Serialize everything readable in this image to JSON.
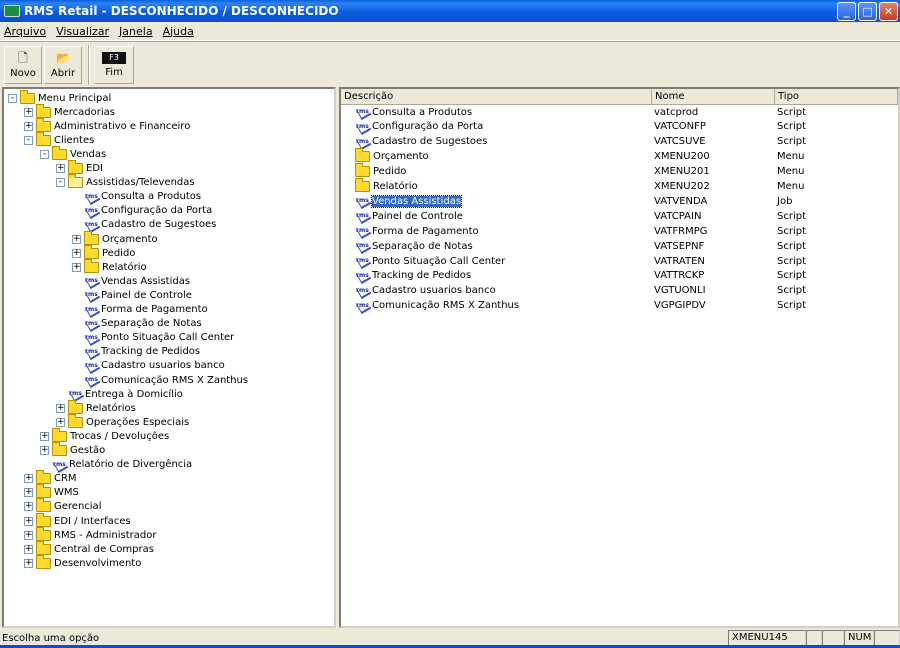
{
  "window": {
    "title": "RMS Retail - DESCONHECIDO / DESCONHECIDO"
  },
  "menu": [
    "Arquivo",
    "Visualizar",
    "Janela",
    "Ajuda"
  ],
  "toolbar": {
    "novo": "Novo",
    "abrir": "Abrir",
    "fim": "Fim",
    "fim_key": "F3"
  },
  "tree": [
    {
      "label": "Menu Principal",
      "icon": "folder",
      "expander": "-"
    },
    {
      "label": "Mercadorias",
      "icon": "folder",
      "expander": "+"
    },
    {
      "label": "Administrativo e Financeiro",
      "icon": "folder",
      "expander": "+"
    },
    {
      "label": "Clientes",
      "icon": "folder",
      "expander": "-"
    },
    {
      "label": "Vendas",
      "icon": "folder",
      "expander": "-"
    },
    {
      "label": "EDI",
      "icon": "folder",
      "expander": "+"
    },
    {
      "label": "Assistidas/Televendas",
      "icon": "folder-open",
      "expander": "-"
    },
    {
      "label": "Consulta a Produtos",
      "icon": "program",
      "expander": ""
    },
    {
      "label": "Configuração da Porta",
      "icon": "program",
      "expander": ""
    },
    {
      "label": "Cadastro de Sugestoes",
      "icon": "program",
      "expander": ""
    },
    {
      "label": "Orçamento",
      "icon": "folder",
      "expander": "+"
    },
    {
      "label": "Pedido",
      "icon": "folder",
      "expander": "+"
    },
    {
      "label": "Relatório",
      "icon": "folder",
      "expander": "+"
    },
    {
      "label": "Vendas Assistidas",
      "icon": "program",
      "expander": ""
    },
    {
      "label": "Painel de Controle",
      "icon": "program",
      "expander": ""
    },
    {
      "label": "Forma de Pagamento",
      "icon": "program",
      "expander": ""
    },
    {
      "label": "Separação de Notas",
      "icon": "program",
      "expander": ""
    },
    {
      "label": "Ponto Situação Call Center",
      "icon": "program",
      "expander": ""
    },
    {
      "label": "Tracking de Pedidos",
      "icon": "program",
      "expander": ""
    },
    {
      "label": "Cadastro usuarios banco",
      "icon": "program",
      "expander": ""
    },
    {
      "label": "Comunicação RMS X Zanthus",
      "icon": "program",
      "expander": ""
    },
    {
      "label": "Entrega à Domicílio",
      "icon": "program",
      "expander": ""
    },
    {
      "label": "Relatórios",
      "icon": "folder",
      "expander": "+"
    },
    {
      "label": "Operações Especiais",
      "icon": "folder",
      "expander": "+"
    },
    {
      "label": "Trocas / Devoluções",
      "icon": "folder",
      "expander": "+"
    },
    {
      "label": "Gestão",
      "icon": "folder",
      "expander": "+"
    },
    {
      "label": "Relatório de Divergência",
      "icon": "program",
      "expander": ""
    },
    {
      "label": "CRM",
      "icon": "folder",
      "expander": "+"
    },
    {
      "label": "WMS",
      "icon": "folder",
      "expander": "+"
    },
    {
      "label": "Gerencial",
      "icon": "folder",
      "expander": "+"
    },
    {
      "label": "EDI / Interfaces",
      "icon": "folder",
      "expander": "+"
    },
    {
      "label": "RMS - Administrador",
      "icon": "folder",
      "expander": "+"
    },
    {
      "label": "Central de Compras",
      "icon": "folder",
      "expander": "+"
    },
    {
      "label": "Desenvolvimento",
      "icon": "folder",
      "expander": "+"
    }
  ],
  "list": {
    "headers": [
      "Descrição",
      "Nome",
      "Tipo"
    ],
    "rows": [
      {
        "desc": "Consulta a Produtos",
        "nome": "vatcprod",
        "tipo": "Script",
        "icon": "program"
      },
      {
        "desc": "Configuração da Porta",
        "nome": "VATCONFP",
        "tipo": "Script",
        "icon": "program"
      },
      {
        "desc": "Cadastro de Sugestoes",
        "nome": "VATCSUVE",
        "tipo": "Script",
        "icon": "program"
      },
      {
        "desc": "Orçamento",
        "nome": "XMENU200",
        "tipo": "Menu",
        "icon": "folder"
      },
      {
        "desc": "Pedido",
        "nome": "XMENU201",
        "tipo": "Menu",
        "icon": "folder"
      },
      {
        "desc": "Relatório",
        "nome": "XMENU202",
        "tipo": "Menu",
        "icon": "folder"
      },
      {
        "desc": "Vendas Assistidas",
        "nome": "VATVENDA",
        "tipo": "Job",
        "icon": "program"
      },
      {
        "desc": "Painel de Controle",
        "nome": "VATCPAIN",
        "tipo": "Script",
        "icon": "program"
      },
      {
        "desc": "Forma de Pagamento",
        "nome": "VATFRMPG",
        "tipo": "Script",
        "icon": "program"
      },
      {
        "desc": "Separação de Notas",
        "nome": "VATSEPNF",
        "tipo": "Script",
        "icon": "program"
      },
      {
        "desc": "Ponto Situação Call Center",
        "nome": "VATRATEN",
        "tipo": "Script",
        "icon": "program"
      },
      {
        "desc": "Tracking de Pedidos",
        "nome": "VATTRCKP",
        "tipo": "Script",
        "icon": "program"
      },
      {
        "desc": "Cadastro usuarios banco",
        "nome": "VGTUONLI",
        "tipo": "Script",
        "icon": "program"
      },
      {
        "desc": "Comunicação RMS X Zanthus",
        "nome": "VGPGIPDV",
        "tipo": "Script",
        "icon": "program"
      }
    ],
    "selected_index": 6
  },
  "status": {
    "message": "Escolha uma opção",
    "menu_code": "XMENU145",
    "num": "NUM"
  }
}
